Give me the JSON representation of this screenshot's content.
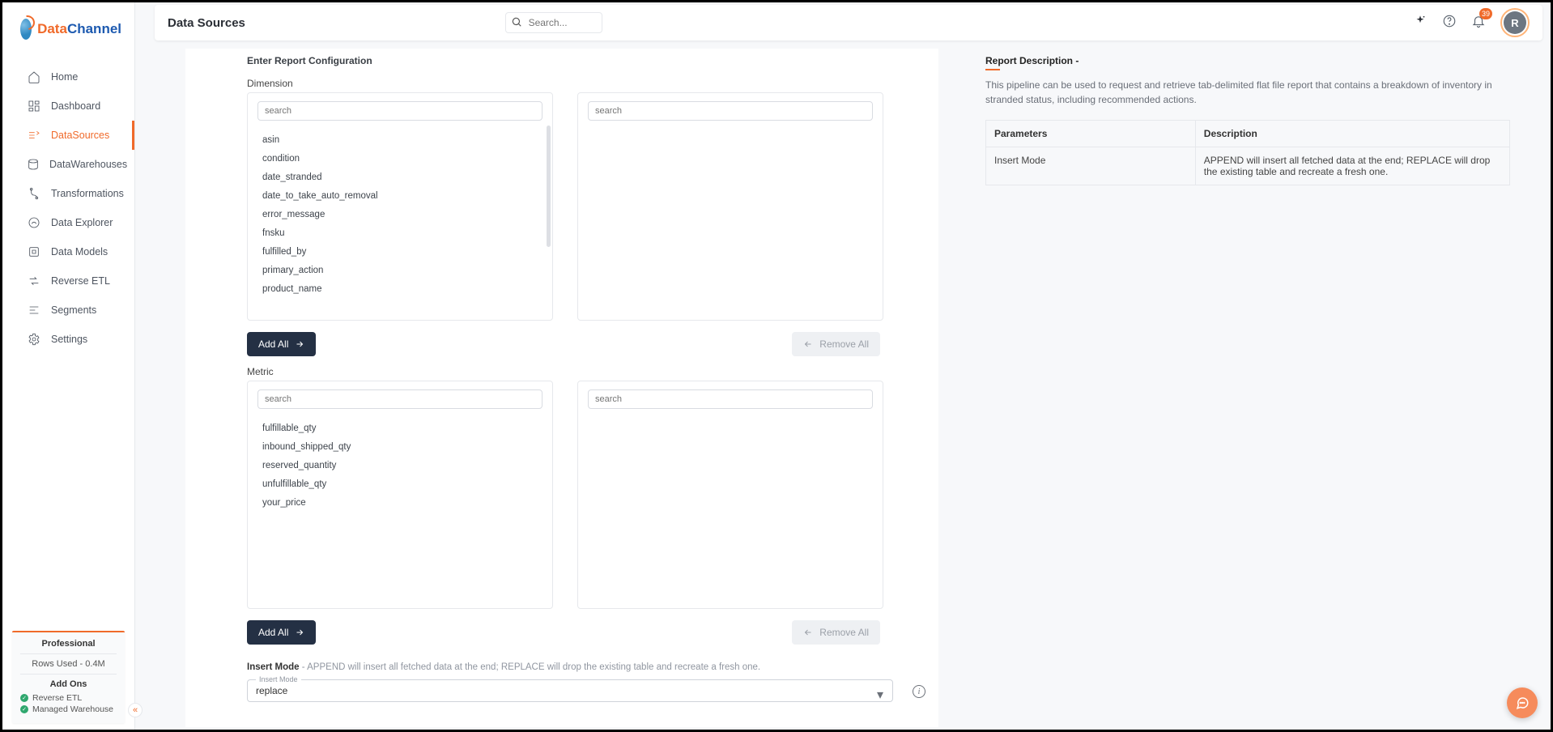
{
  "brand": {
    "part1": "Data",
    "part2": "Channel"
  },
  "header": {
    "title": "Data Sources",
    "search_placeholder": "Search...",
    "notif_count": "39",
    "avatar_initial": "R"
  },
  "nav": {
    "home": "Home",
    "dashboard": "Dashboard",
    "datasources": "DataSources",
    "datawarehouses": "DataWarehouses",
    "transformations": "Transformations",
    "data_explorer": "Data Explorer",
    "data_models": "Data Models",
    "reverse_etl": "Reverse ETL",
    "segments": "Segments",
    "settings": "Settings"
  },
  "plan": {
    "name": "Professional",
    "rows": "Rows Used - 0.4M",
    "addons_title": "Add Ons",
    "addons": {
      "reverse_etl": "Reverse ETL",
      "managed_wh": "Managed Warehouse"
    }
  },
  "config": {
    "section_title": "Enter Report Configuration",
    "dimension_label": "Dimension",
    "metric_label": "Metric",
    "search_placeholder": "search",
    "dimensions": {
      "asin": "asin",
      "condition": "condition",
      "date_stranded": "date_stranded",
      "date_to_take_auto_removal": "date_to_take_auto_removal",
      "error_message": "error_message",
      "fnsku": "fnsku",
      "fulfilled_by": "fulfilled_by",
      "primary_action": "primary_action",
      "product_name": "product_name"
    },
    "metrics": {
      "fulfillable_qty": "fulfillable_qty",
      "inbound_shipped_qty": "inbound_shipped_qty",
      "reserved_quantity": "reserved_quantity",
      "unfulfillable_qty": "unfulfillable_qty",
      "your_price": "your_price"
    },
    "add_all": "Add All",
    "remove_all": "Remove All",
    "insert_mode_label": "Insert Mode",
    "insert_mode_hint": " - APPEND will insert all fetched data at the end; REPLACE will drop the existing table and recreate a fresh one.",
    "insert_mode_legend": "Insert Mode",
    "insert_mode_value": "replace"
  },
  "rpanel": {
    "title": "Report Description -",
    "desc": "This pipeline can be used to request and retrieve tab-delimited flat file report that contains a breakdown of inventory in stranded status, including recommended actions.",
    "th_param": "Parameters",
    "th_desc": "Description",
    "row1_param": "Insert Mode",
    "row1_desc": "APPEND will insert all fetched data at the end; REPLACE will drop the existing table and recreate a fresh one."
  }
}
